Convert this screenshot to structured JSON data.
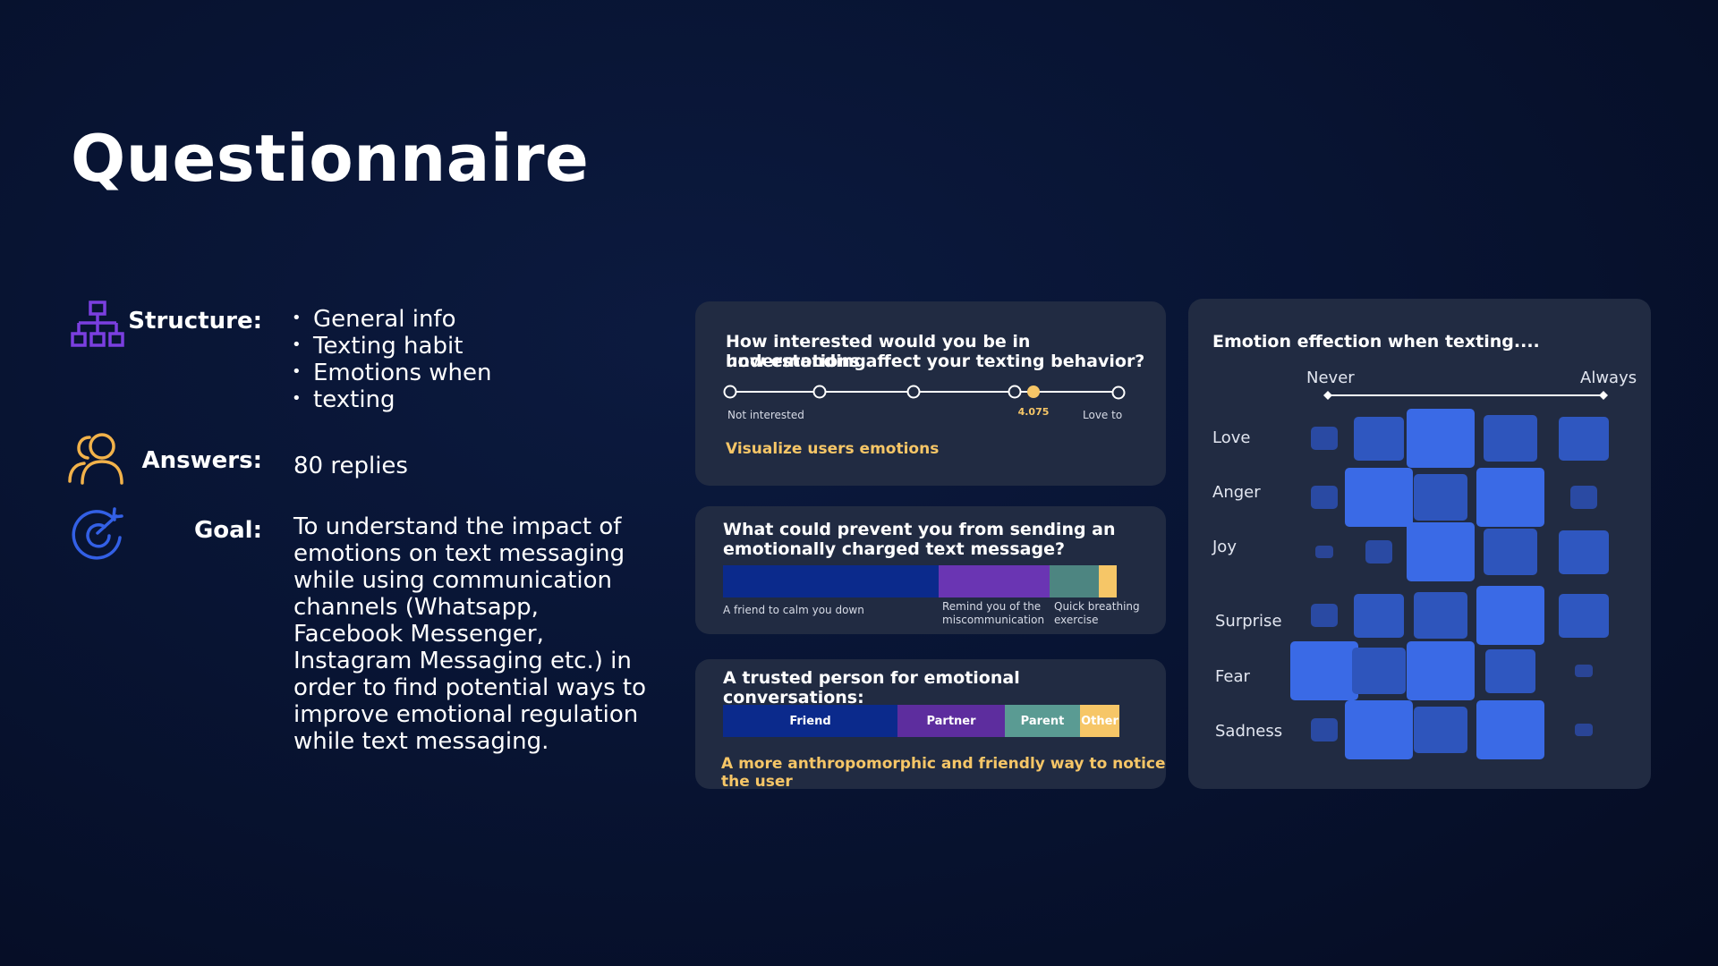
{
  "page": {
    "title": "Questionnaire"
  },
  "structure": {
    "label": "Structure:",
    "items": [
      "General info",
      "Texting habit",
      "Emotions when",
      "texting"
    ]
  },
  "answers": {
    "label": "Answers:",
    "value": "80 replies"
  },
  "goal": {
    "label": "Goal:",
    "lines": [
      "To understand the impact of",
      "emotions on text messaging",
      "while using communication",
      "channels (Whatsapp,",
      "Facebook Messenger,",
      "Instagram Messaging etc.) in",
      "order to find potential ways to",
      "improve emotional regulation",
      "while text messaging."
    ]
  },
  "card1": {
    "question_line1": "How interested would you be in understanding",
    "question_line2": "how emotions affect your texting behavior?",
    "scale_min_label": "Not interested",
    "scale_max_label": "Love to",
    "value_label": "4.075",
    "value": 4.075,
    "scale_points": 5,
    "insight": "Visualize users emotions"
  },
  "card2": {
    "question_line1": "What could prevent you from sending an",
    "question_line2": "emotionally charged text message?",
    "segments": [
      {
        "label_line1": "A friend to calm you down",
        "label_line2": "",
        "share": 0.55,
        "color": "#0b2a8c"
      },
      {
        "label_line1": "Remind you of the",
        "label_line2": "miscommunication",
        "share": 0.28,
        "color": "#6a35b3"
      },
      {
        "label_line1": "Quick breathing",
        "label_line2": "exercise",
        "share": 0.125,
        "color": "#4d8581"
      },
      {
        "label_line1": "",
        "label_line2": "",
        "share": 0.045,
        "color": "#f6c667"
      }
    ]
  },
  "card3": {
    "question": "A trusted person for emotional conversations:",
    "segments": [
      {
        "label": "Friend",
        "share": 0.44,
        "color": "#0b2a8c"
      },
      {
        "label": "Partner",
        "share": 0.27,
        "color": "#5d2d9e"
      },
      {
        "label": "Parent",
        "share": 0.19,
        "color": "#5a9b93"
      },
      {
        "label": "Other",
        "share": 0.1,
        "color": "#f6c667"
      }
    ],
    "insight": "A more anthropomorphic and friendly way to notice the user"
  },
  "heatmap": {
    "title": "Emotion effection when texting....",
    "scale_min": "Never",
    "scale_max": "Always",
    "rows": [
      {
        "label": "Love",
        "intensity": [
          1,
          2,
          3,
          4,
          2
        ]
      },
      {
        "label": "Anger",
        "intensity": [
          1,
          3,
          4,
          3,
          1
        ]
      },
      {
        "label": "Joy",
        "intensity": [
          0,
          1,
          3,
          4,
          2
        ]
      },
      {
        "label": "Surprise",
        "intensity": [
          1,
          2,
          4,
          3,
          2
        ]
      },
      {
        "label": "Fear",
        "intensity": [
          3,
          4,
          3,
          2,
          0
        ]
      },
      {
        "label": "Sadness",
        "intensity": [
          1,
          3,
          4,
          3,
          0
        ]
      }
    ]
  }
}
